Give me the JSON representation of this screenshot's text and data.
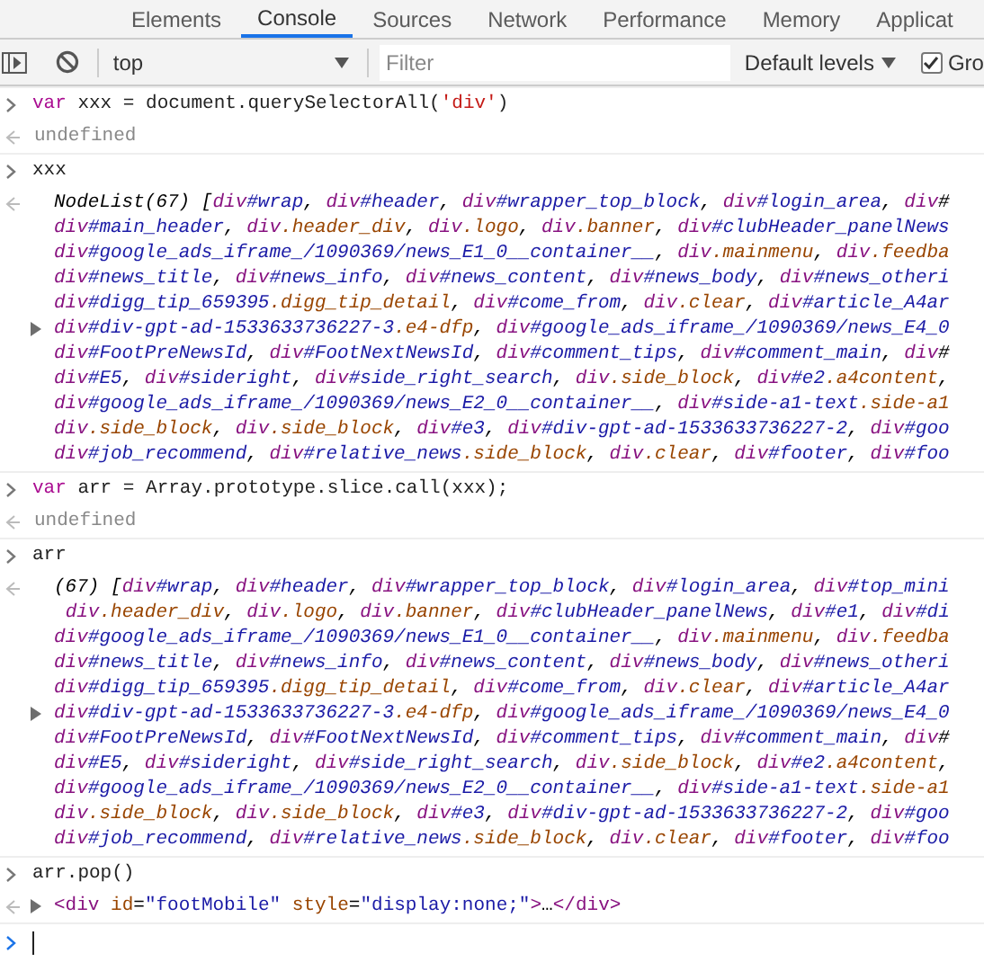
{
  "tabs": [
    {
      "label": "Elements",
      "selected": false
    },
    {
      "label": "Console",
      "selected": true
    },
    {
      "label": "Sources",
      "selected": false
    },
    {
      "label": "Network",
      "selected": false
    },
    {
      "label": "Performance",
      "selected": false
    },
    {
      "label": "Memory",
      "selected": false
    },
    {
      "label": "Applicat",
      "selected": false
    }
  ],
  "toolbar": {
    "context": "top",
    "filter_placeholder": "Filter",
    "levels": "Default levels",
    "group_checkbox": {
      "label": "Gro",
      "checked": true
    }
  },
  "entries": [
    {
      "kind": "input",
      "text": "var xxx = document.querySelectorAll('div')"
    },
    {
      "kind": "undefined",
      "text": "undefined"
    },
    {
      "kind": "input",
      "text": "xxx"
    },
    {
      "kind": "list",
      "expanded": false,
      "lines": [
        "NodeList(67) [div#wrap, div#header, div#wrapper_top_block, div#login_area, div#",
        "div#main_header, div.header_div, div.logo, div.banner, div#clubHeader_panelNews",
        "div#google_ads_iframe_/1090369/news_E1_0__container__, div.mainmenu, div.feedba",
        "div#news_title, div#news_info, div#news_content, div#news_body, div#news_otheri",
        "div#digg_tip_659395.digg_tip_detail, div#come_from, div.clear, div#article_A4ar",
        "div#div-gpt-ad-1533633736227-3.e4-dfp, div#google_ads_iframe_/1090369/news_E4_0",
        "div#FootPreNewsId, div#FootNextNewsId, div#comment_tips, div#comment_main, div#",
        "div#E5, div#sideright, div#side_right_search, div.side_block, div#e2.a4content,",
        "div#google_ads_iframe_/1090369/news_E2_0__container__, div#side-a1-text.side-a1",
        "div.side_block, div.side_block, div#e3, div#div-gpt-ad-1533633736227-2, div#goo",
        "div#job_recommend, div#relative_news.side_block, div.clear, div#footer, div#foo"
      ]
    },
    {
      "kind": "input",
      "text": "var arr = Array.prototype.slice.call(xxx);"
    },
    {
      "kind": "undefined",
      "text": "undefined"
    },
    {
      "kind": "input",
      "text": "arr"
    },
    {
      "kind": "list",
      "expanded": false,
      "lines": [
        "(67) [div#wrap, div#header, div#wrapper_top_block, div#login_area, div#top_mini",
        " div.header_div, div.logo, div.banner, div#clubHeader_panelNews, div#e1, div#di",
        "div#google_ads_iframe_/1090369/news_E1_0__container__, div.mainmenu, div.feedba",
        "div#news_title, div#news_info, div#news_content, div#news_body, div#news_otheri",
        "div#digg_tip_659395.digg_tip_detail, div#come_from, div.clear, div#article_A4ar",
        "div#div-gpt-ad-1533633736227-3.e4-dfp, div#google_ads_iframe_/1090369/news_E4_0",
        "div#FootPreNewsId, div#FootNextNewsId, div#comment_tips, div#comment_main, div#",
        "div#E5, div#sideright, div#side_right_search, div.side_block, div#e2.a4content,",
        "div#google_ads_iframe_/1090369/news_E2_0__container__, div#side-a1-text.side-a1",
        "div.side_block, div.side_block, div#e3, div#div-gpt-ad-1533633736227-2, div#goo",
        "div#job_recommend, div#relative_news.side_block, div.clear, div#footer, div#foo"
      ]
    },
    {
      "kind": "input",
      "text": "arr.pop()"
    },
    {
      "kind": "element",
      "expanded": false,
      "text": "<div id=\"footMobile\" style=\"display:none;\">…</div>"
    },
    {
      "kind": "prompt"
    }
  ]
}
